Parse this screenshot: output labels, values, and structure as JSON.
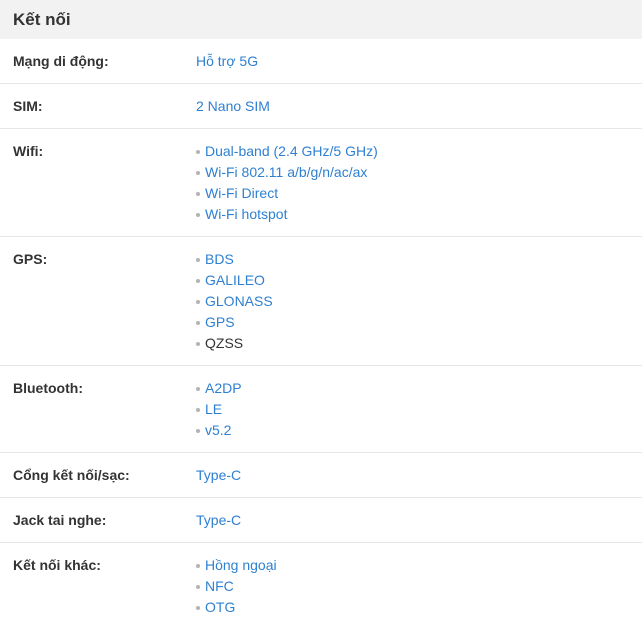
{
  "section": {
    "title": "Kết nối"
  },
  "rows": {
    "mobile": {
      "label": "Mạng di động:",
      "value": "Hỗ trợ 5G"
    },
    "sim": {
      "label": "SIM:",
      "value": "2 Nano SIM"
    },
    "wifi": {
      "label": "Wifi:",
      "values": [
        "Dual-band (2.4 GHz/5 GHz)",
        "Wi-Fi 802.11 a/b/g/n/ac/ax",
        "Wi-Fi Direct",
        "Wi-Fi hotspot"
      ]
    },
    "gps": {
      "label": "GPS:",
      "values": [
        "BDS",
        "GALILEO",
        "GLONASS",
        "GPS",
        "QZSS"
      ]
    },
    "bluetooth": {
      "label": "Bluetooth:",
      "values": [
        "A2DP",
        "LE",
        "v5.2"
      ]
    },
    "port": {
      "label": "Cổng kết nối/sạc:",
      "value": "Type-C"
    },
    "jack": {
      "label": "Jack tai nghe:",
      "value": "Type-C"
    },
    "other": {
      "label": "Kết nối khác:",
      "values": [
        "Hồng ngoại",
        "NFC",
        "OTG"
      ]
    }
  },
  "colors": {
    "link": "#2f80d1",
    "header_bg": "#f2f2f2",
    "text": "#333333"
  }
}
